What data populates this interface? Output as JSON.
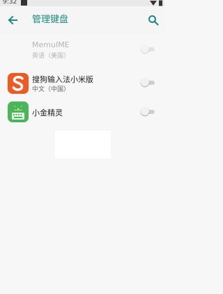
{
  "status_bar": {
    "time": "9:32",
    "icons": [
      "notification-square",
      "wifi-icon",
      "battery-icon"
    ]
  },
  "app_bar": {
    "title": "管理键盘",
    "back_icon": "arrow-back-icon",
    "search_icon": "search-icon",
    "accent_color": "#1a8a80"
  },
  "keyboards": [
    {
      "name": "MemuIME",
      "subtitle": "英语（美国）",
      "enabled": false,
      "disabled": true,
      "icon": "none"
    },
    {
      "name": "搜狗输入法小米版",
      "subtitle": "中文（中国）",
      "enabled": false,
      "disabled": false,
      "icon": "sogou-icon"
    },
    {
      "name": "小金精灵",
      "subtitle": "",
      "enabled": false,
      "disabled": false,
      "icon": "android-keyboard-icon"
    }
  ]
}
